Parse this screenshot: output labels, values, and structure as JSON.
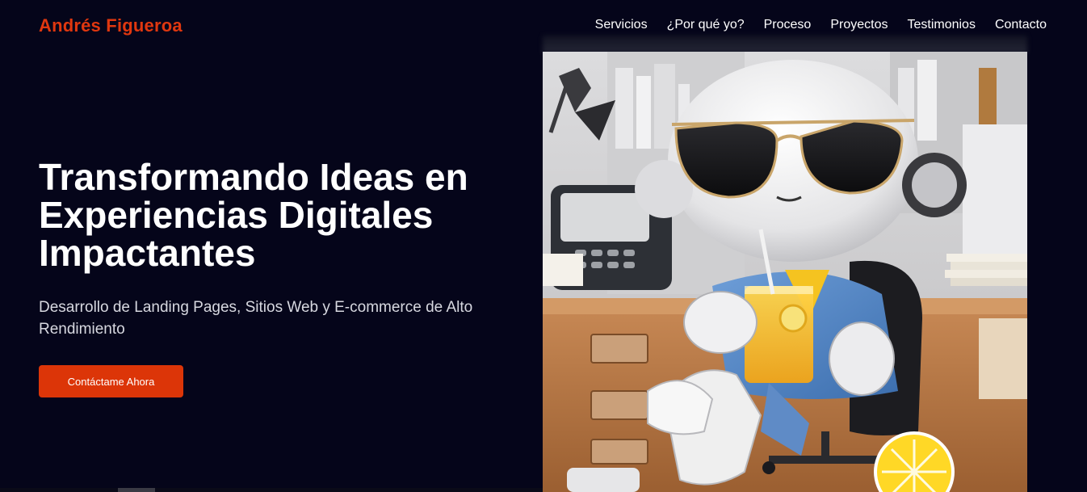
{
  "header": {
    "logo": "Andrés Figueroa",
    "nav": [
      "Servicios",
      "¿Por qué yo?",
      "Proceso",
      "Proyectos",
      "Testimonios",
      "Contacto"
    ]
  },
  "hero": {
    "title_lines": [
      "Transformando Ideas en",
      "Experiencias Digitales",
      "Impactantes"
    ],
    "subtitle": "Desarrollo de Landing Pages, Sitios Web y E-commerce de Alto Rendimiento",
    "cta_label": "Contáctame Ahora"
  },
  "colors": {
    "background": "#05051a",
    "accent": "#dc3508",
    "logo": "#e0370f"
  },
  "image": {
    "subject": "robot-with-sunglasses-drinking-lemonade"
  }
}
